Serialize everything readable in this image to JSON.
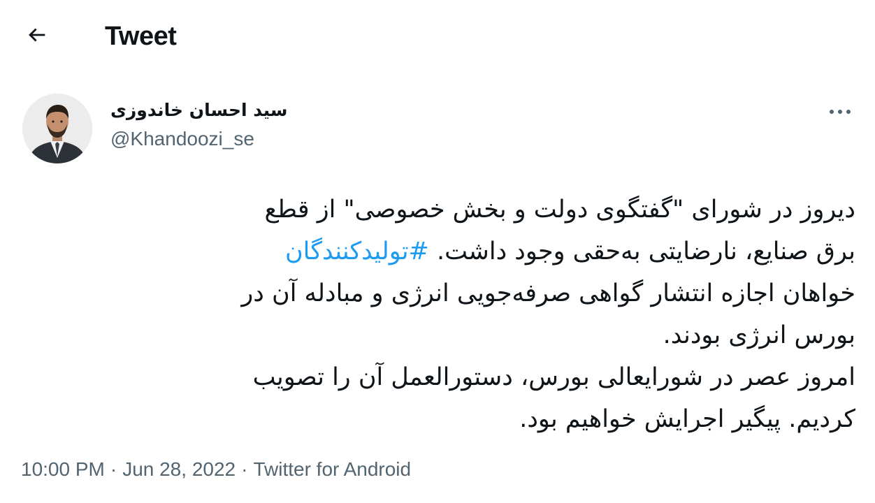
{
  "header": {
    "title": "Tweet",
    "back_icon": "arrow-left-icon"
  },
  "author": {
    "name": "سید احسان خاندوزی",
    "handle": "@Khandoozi_se"
  },
  "tweet": {
    "line1": "دیروز در شورای \"گفتگوی دولت و بخش خصوصی\" از قطع",
    "line2_text": "برق صنایع، نارضایتی به‌حقی وجود داشت.",
    "hashtag": "#تولیدکنندگان",
    "line3": "خواهان اجازه انتشار گواهی صرفه‌جویی انرژی و مبادله آن در",
    "line4": "بورس انرژی بودند.",
    "line5": "امروز عصر در شورایعالی بورس، دستورالعمل آن را تصویب",
    "line6": "کردیم. پیگیر اجرایش خواهیم بود."
  },
  "meta": {
    "time": "10:00 PM",
    "separator": "·",
    "date": "Jun 28, 2022",
    "source": "Twitter for Android"
  },
  "colors": {
    "text": "#0f1419",
    "secondary": "#536471",
    "link": "#1d9bf0"
  }
}
